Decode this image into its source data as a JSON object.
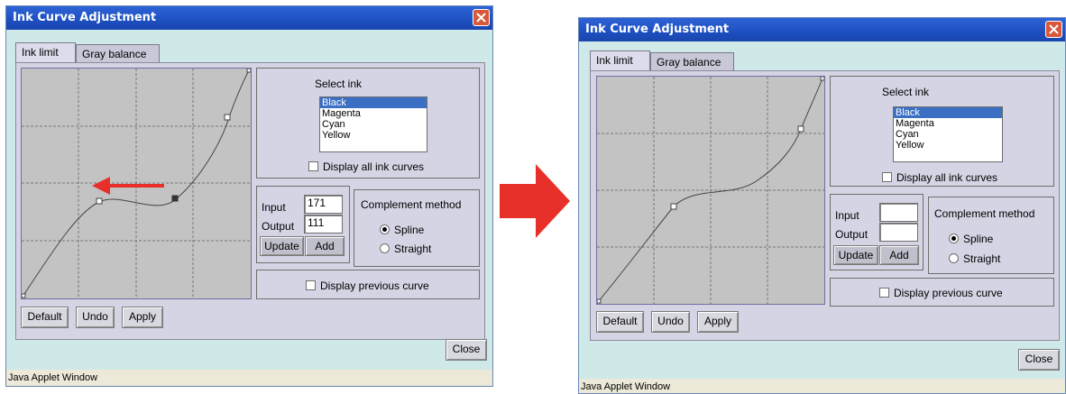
{
  "window": {
    "title": "Ink Curve Adjustment",
    "status": "Java Applet Window",
    "close_label": "Close"
  },
  "tabs": [
    {
      "label": "Ink limit",
      "active": true
    },
    {
      "label": "Gray balance",
      "active": false
    }
  ],
  "select_ink": {
    "label": "Select ink",
    "options": [
      "Black",
      "Magenta",
      "Cyan",
      "Yellow"
    ],
    "selected": "Black"
  },
  "display_all_label": "Display all ink curves",
  "input_label": "Input",
  "output_label": "Output",
  "update_label": "Update",
  "add_label": "Add",
  "complement": {
    "title": "Complement method",
    "spline_label": "Spline",
    "straight_label": "Straight",
    "selected": "Spline"
  },
  "display_prev_label": "Display previous curve",
  "buttons": {
    "default": "Default",
    "undo": "Undo",
    "apply": "Apply"
  },
  "before": {
    "input_value": "171",
    "output_value": "111"
  },
  "after": {
    "input_value": "",
    "output_value": ""
  },
  "colors": {
    "arrow": "#e8302a",
    "title_bar": "#1f52c4",
    "selection": "#3a6fc4"
  }
}
